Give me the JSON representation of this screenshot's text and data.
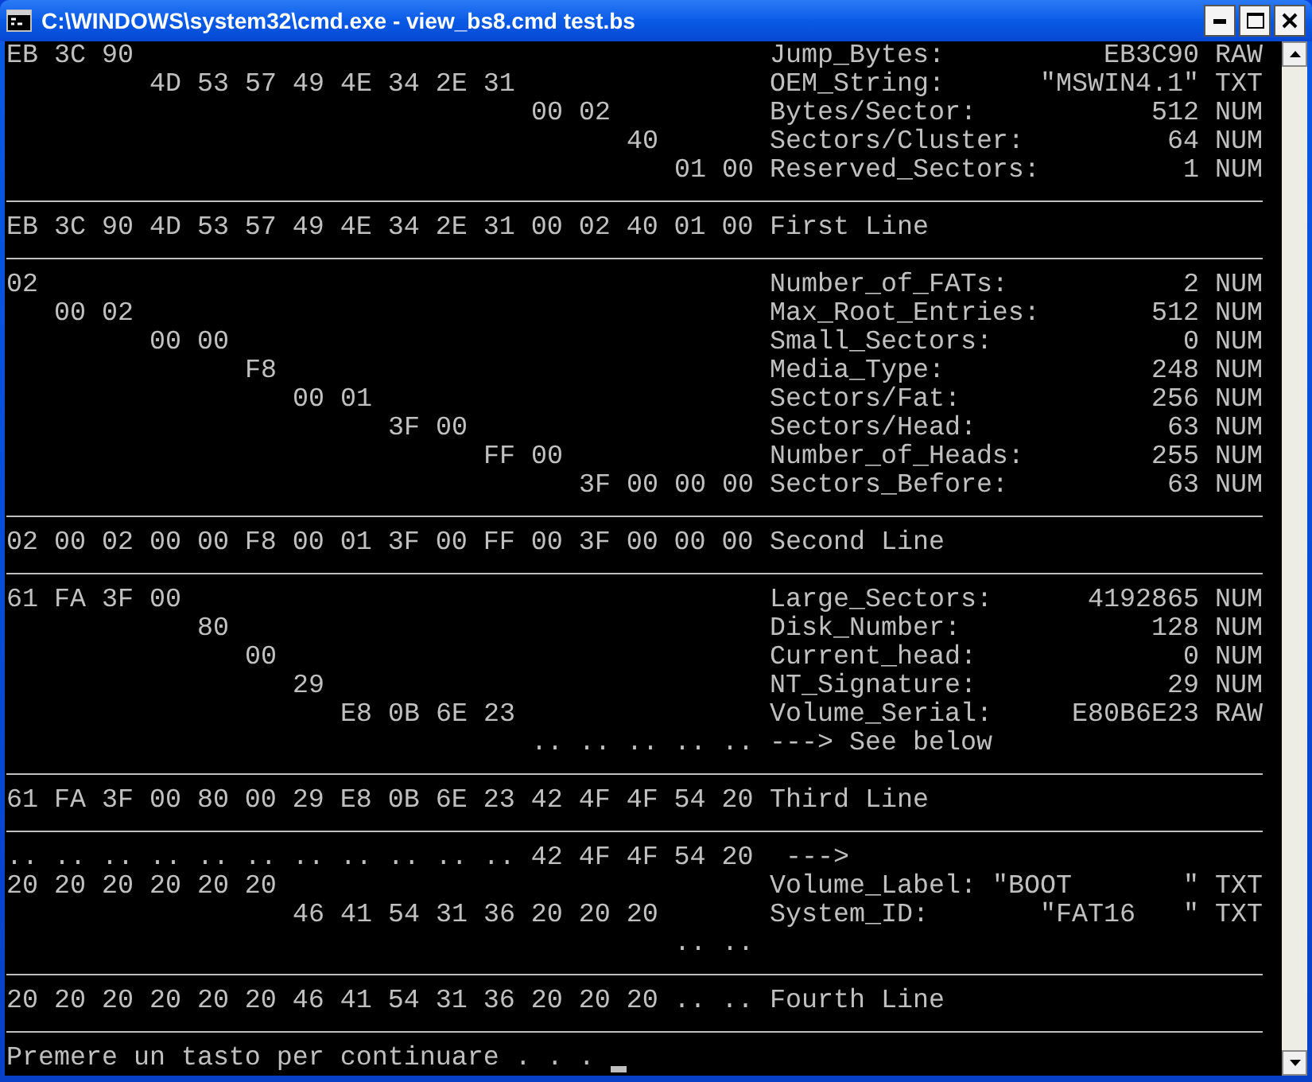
{
  "window": {
    "title": "C:\\WINDOWS\\system32\\cmd.exe - view_bs8.cmd test.bs"
  },
  "console": {
    "sections": [
      [
        {
          "hex": "EB 3C 90",
          "field": "Jump_Bytes:",
          "value": "EB3C90",
          "type": "RAW"
        },
        {
          "hex": "4D 53 57 49 4E 34 2E 31",
          "field": "OEM_String:",
          "value": "\"MSWIN4.1\"",
          "type": "TXT"
        },
        {
          "hex": "00 02",
          "field": "Bytes/Sector:",
          "value": "512",
          "type": "NUM"
        },
        {
          "hex": "40",
          "field": "Sectors/Cluster:",
          "value": "64",
          "type": "NUM"
        },
        {
          "hex": "01 00",
          "field": "Reserved_Sectors:",
          "value": "1",
          "type": "NUM"
        }
      ],
      [
        {
          "hex": "EB 3C 90 4D 53 57 49 4E 34 2E 31 00 02 40 01 00",
          "field": "First Line"
        }
      ],
      [
        {
          "hex": "02",
          "field": "Number_of_FATs:",
          "value": "2",
          "type": "NUM"
        },
        {
          "hex": "00 02",
          "field": "Max_Root_Entries:",
          "value": "512",
          "type": "NUM"
        },
        {
          "hex": "00 00",
          "field": "Small_Sectors:",
          "value": "0",
          "type": "NUM"
        },
        {
          "hex": "F8",
          "field": "Media_Type:",
          "value": "248",
          "type": "NUM"
        },
        {
          "hex": "00 01",
          "field": "Sectors/Fat:",
          "value": "256",
          "type": "NUM"
        },
        {
          "hex": "3F 00",
          "field": "Sectors/Head:",
          "value": "63",
          "type": "NUM"
        },
        {
          "hex": "FF 00",
          "field": "Number_of_Heads:",
          "value": "255",
          "type": "NUM"
        },
        {
          "hex": "3F 00 00 00",
          "field": "Sectors_Before:",
          "value": "63",
          "type": "NUM"
        }
      ],
      [
        {
          "hex": "02 00 02 00 00 F8 00 01 3F 00 FF 00 3F 00 00 00",
          "field": "Second Line"
        }
      ],
      [
        {
          "hex": "61 FA 3F 00",
          "field": "Large_Sectors:",
          "value": "4192865",
          "type": "NUM"
        },
        {
          "hex": "80",
          "field": "Disk_Number:",
          "value": "128",
          "type": "NUM"
        },
        {
          "hex": "00",
          "field": "Current_head:",
          "value": "0",
          "type": "NUM"
        },
        {
          "hex": "29",
          "field": "NT_Signature:",
          "value": "29",
          "type": "NUM"
        },
        {
          "hex": "E8 0B 6E 23",
          "field": "Volume_Serial:",
          "value": "E80B6E23",
          "type": "RAW"
        },
        {
          "hex": ".. .. .. .. ..",
          "field": "---> See below"
        }
      ],
      [
        {
          "hex": "61 FA 3F 00 80 00 29 E8 0B 6E 23 42 4F 4F 54 20",
          "field": "Third Line"
        }
      ],
      [
        {
          "hex": ".. .. .. .. .. .. .. .. .. .. .. 42 4F 4F 54 20",
          "arrow": "--->"
        },
        {
          "hex": "20 20 20 20 20 20",
          "field": "Volume_Label:",
          "value": "\"BOOT       \"",
          "type": "TXT"
        },
        {
          "hex": "46 41 54 31 36 20 20 20",
          "field": "System_ID:",
          "value": "\"FAT16   \"",
          "type": "TXT"
        },
        {
          "hex": ".. .."
        }
      ],
      [
        {
          "hex": "20 20 20 20 20 20 46 41 54 31 36 20 20 20 .. ..",
          "field": "Fourth Line"
        }
      ]
    ],
    "prompt": "Premere un tasto per continuare . . ."
  }
}
